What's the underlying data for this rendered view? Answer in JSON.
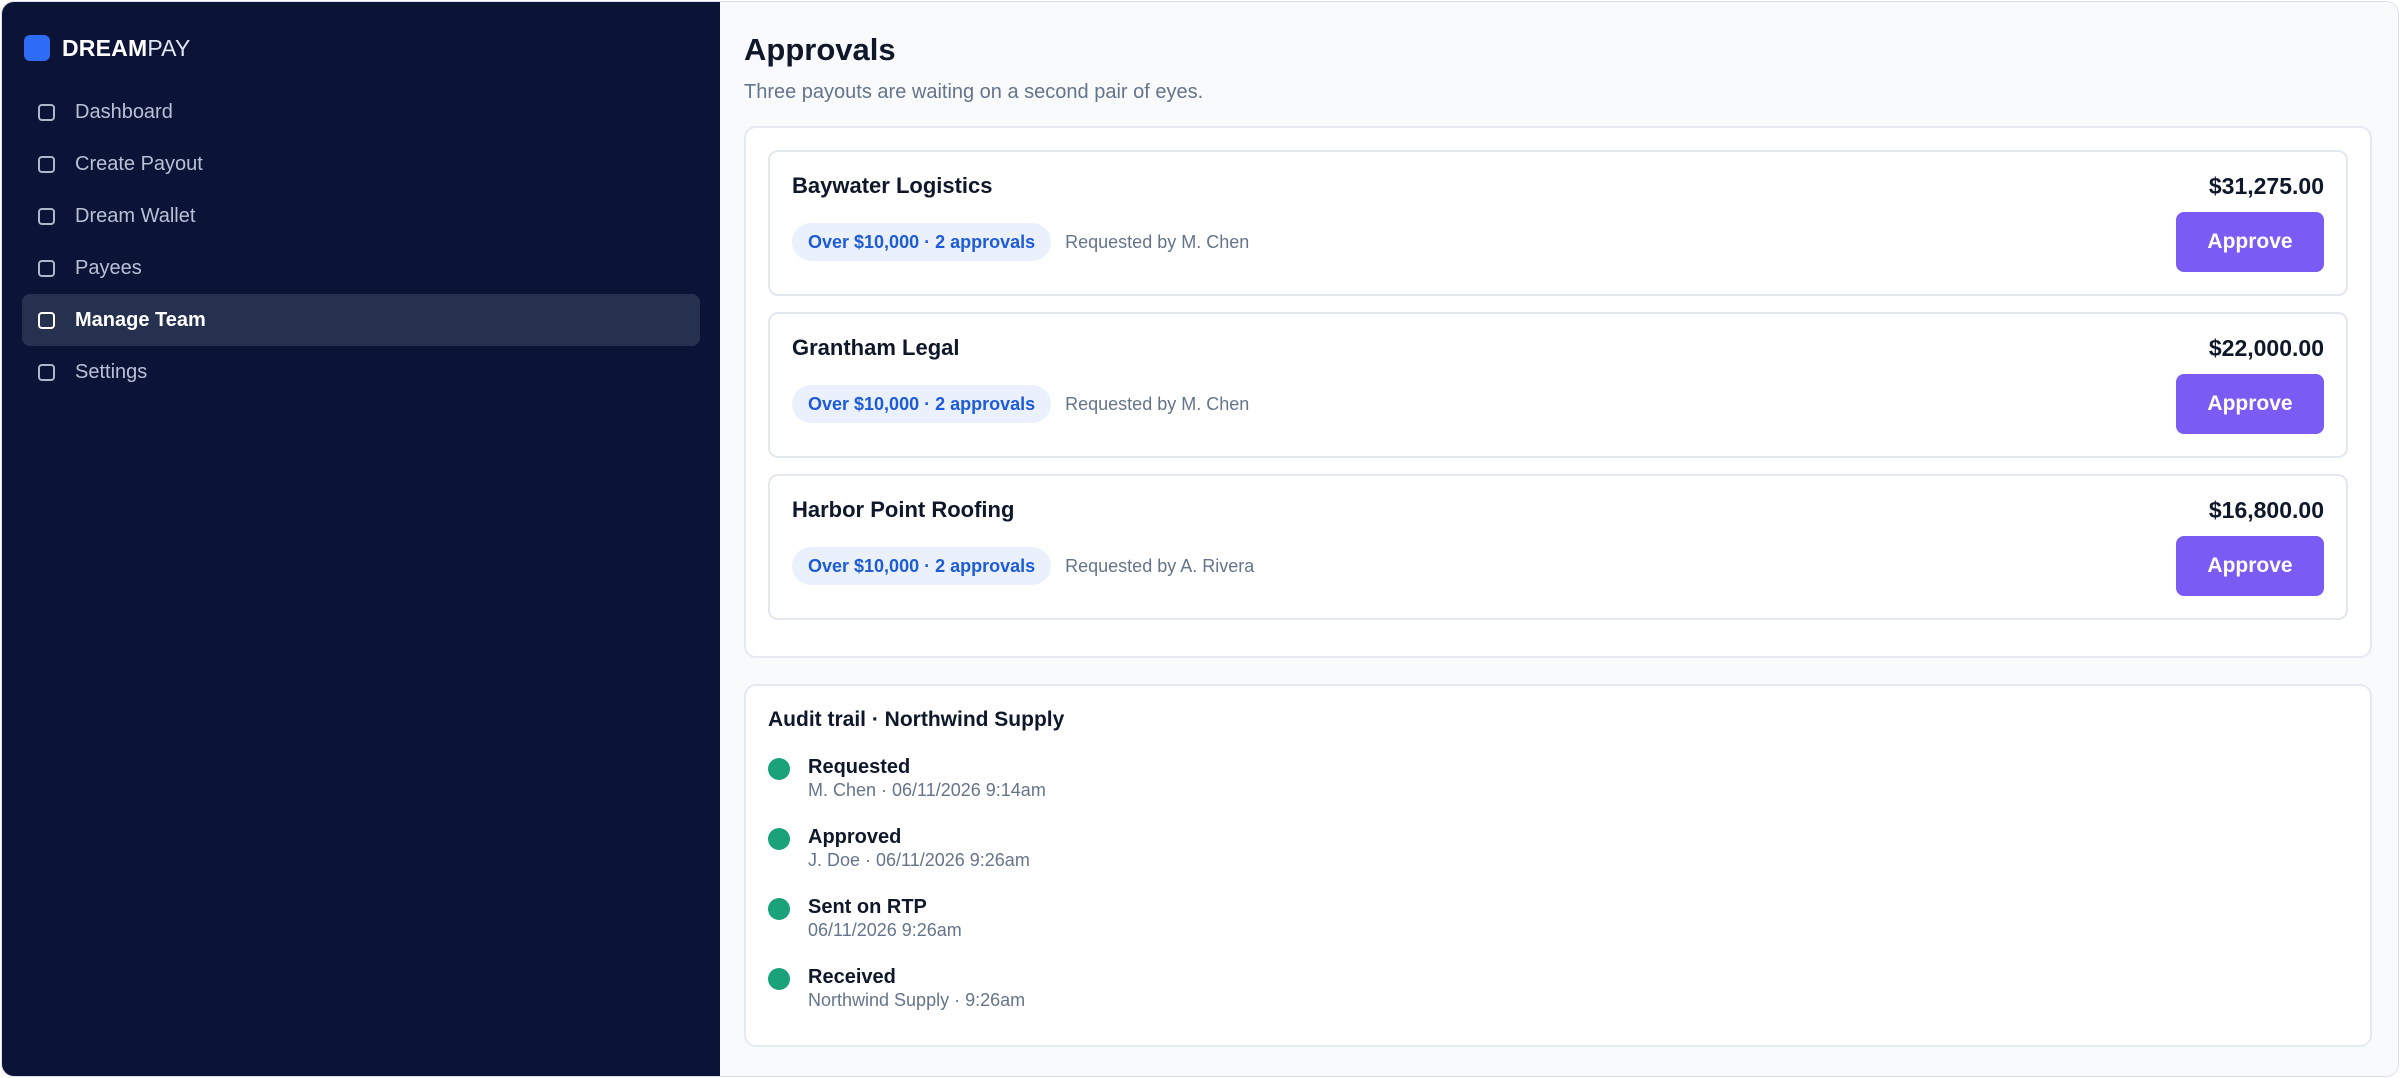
{
  "brand": {
    "bold": "DREAM",
    "light": "PAY",
    "accent": "#2f6cf6"
  },
  "sidebar": {
    "items": [
      {
        "label": "Dashboard",
        "icon": "square-icon",
        "active": false
      },
      {
        "label": "Create Payout",
        "icon": "square-icon",
        "active": false
      },
      {
        "label": "Dream Wallet",
        "icon": "square-icon",
        "active": false
      },
      {
        "label": "Payees",
        "icon": "square-icon",
        "active": false
      },
      {
        "label": "Manage Team",
        "icon": "square-icon",
        "active": true
      },
      {
        "label": "Settings",
        "icon": "square-icon",
        "active": false
      }
    ]
  },
  "header": {
    "title": "Approvals",
    "subtitle": "Three payouts are waiting on a second pair of eyes."
  },
  "approvals": [
    {
      "payee": "Baywater Logistics",
      "amount": "$31,275.00",
      "badge": "Over $10,000 · 2 approvals",
      "requested_by": "Requested by M. Chen",
      "button": "Approve"
    },
    {
      "payee": "Grantham Legal",
      "amount": "$22,000.00",
      "badge": "Over $10,000 · 2 approvals",
      "requested_by": "Requested by M. Chen",
      "button": "Approve"
    },
    {
      "payee": "Harbor Point Roofing",
      "amount": "$16,800.00",
      "badge": "Over $10,000 · 2 approvals",
      "requested_by": "Requested by A. Rivera",
      "button": "Approve"
    }
  ],
  "audit": {
    "title": "Audit trail · Northwind Supply",
    "events": [
      {
        "title": "Requested",
        "detail": "M. Chen · 06/11/2026 9:14am"
      },
      {
        "title": "Approved",
        "detail": "J. Doe · 06/11/2026 9:26am"
      },
      {
        "title": "Sent on RTP",
        "detail": "06/11/2026 9:26am"
      },
      {
        "title": "Received",
        "detail": "Northwind Supply · 9:26am"
      }
    ]
  },
  "colors": {
    "sidebar_bg": "#0b1437",
    "button": "#7a5cf5",
    "badge_text": "#1e5bd6",
    "status_dot": "#1aa37a"
  }
}
